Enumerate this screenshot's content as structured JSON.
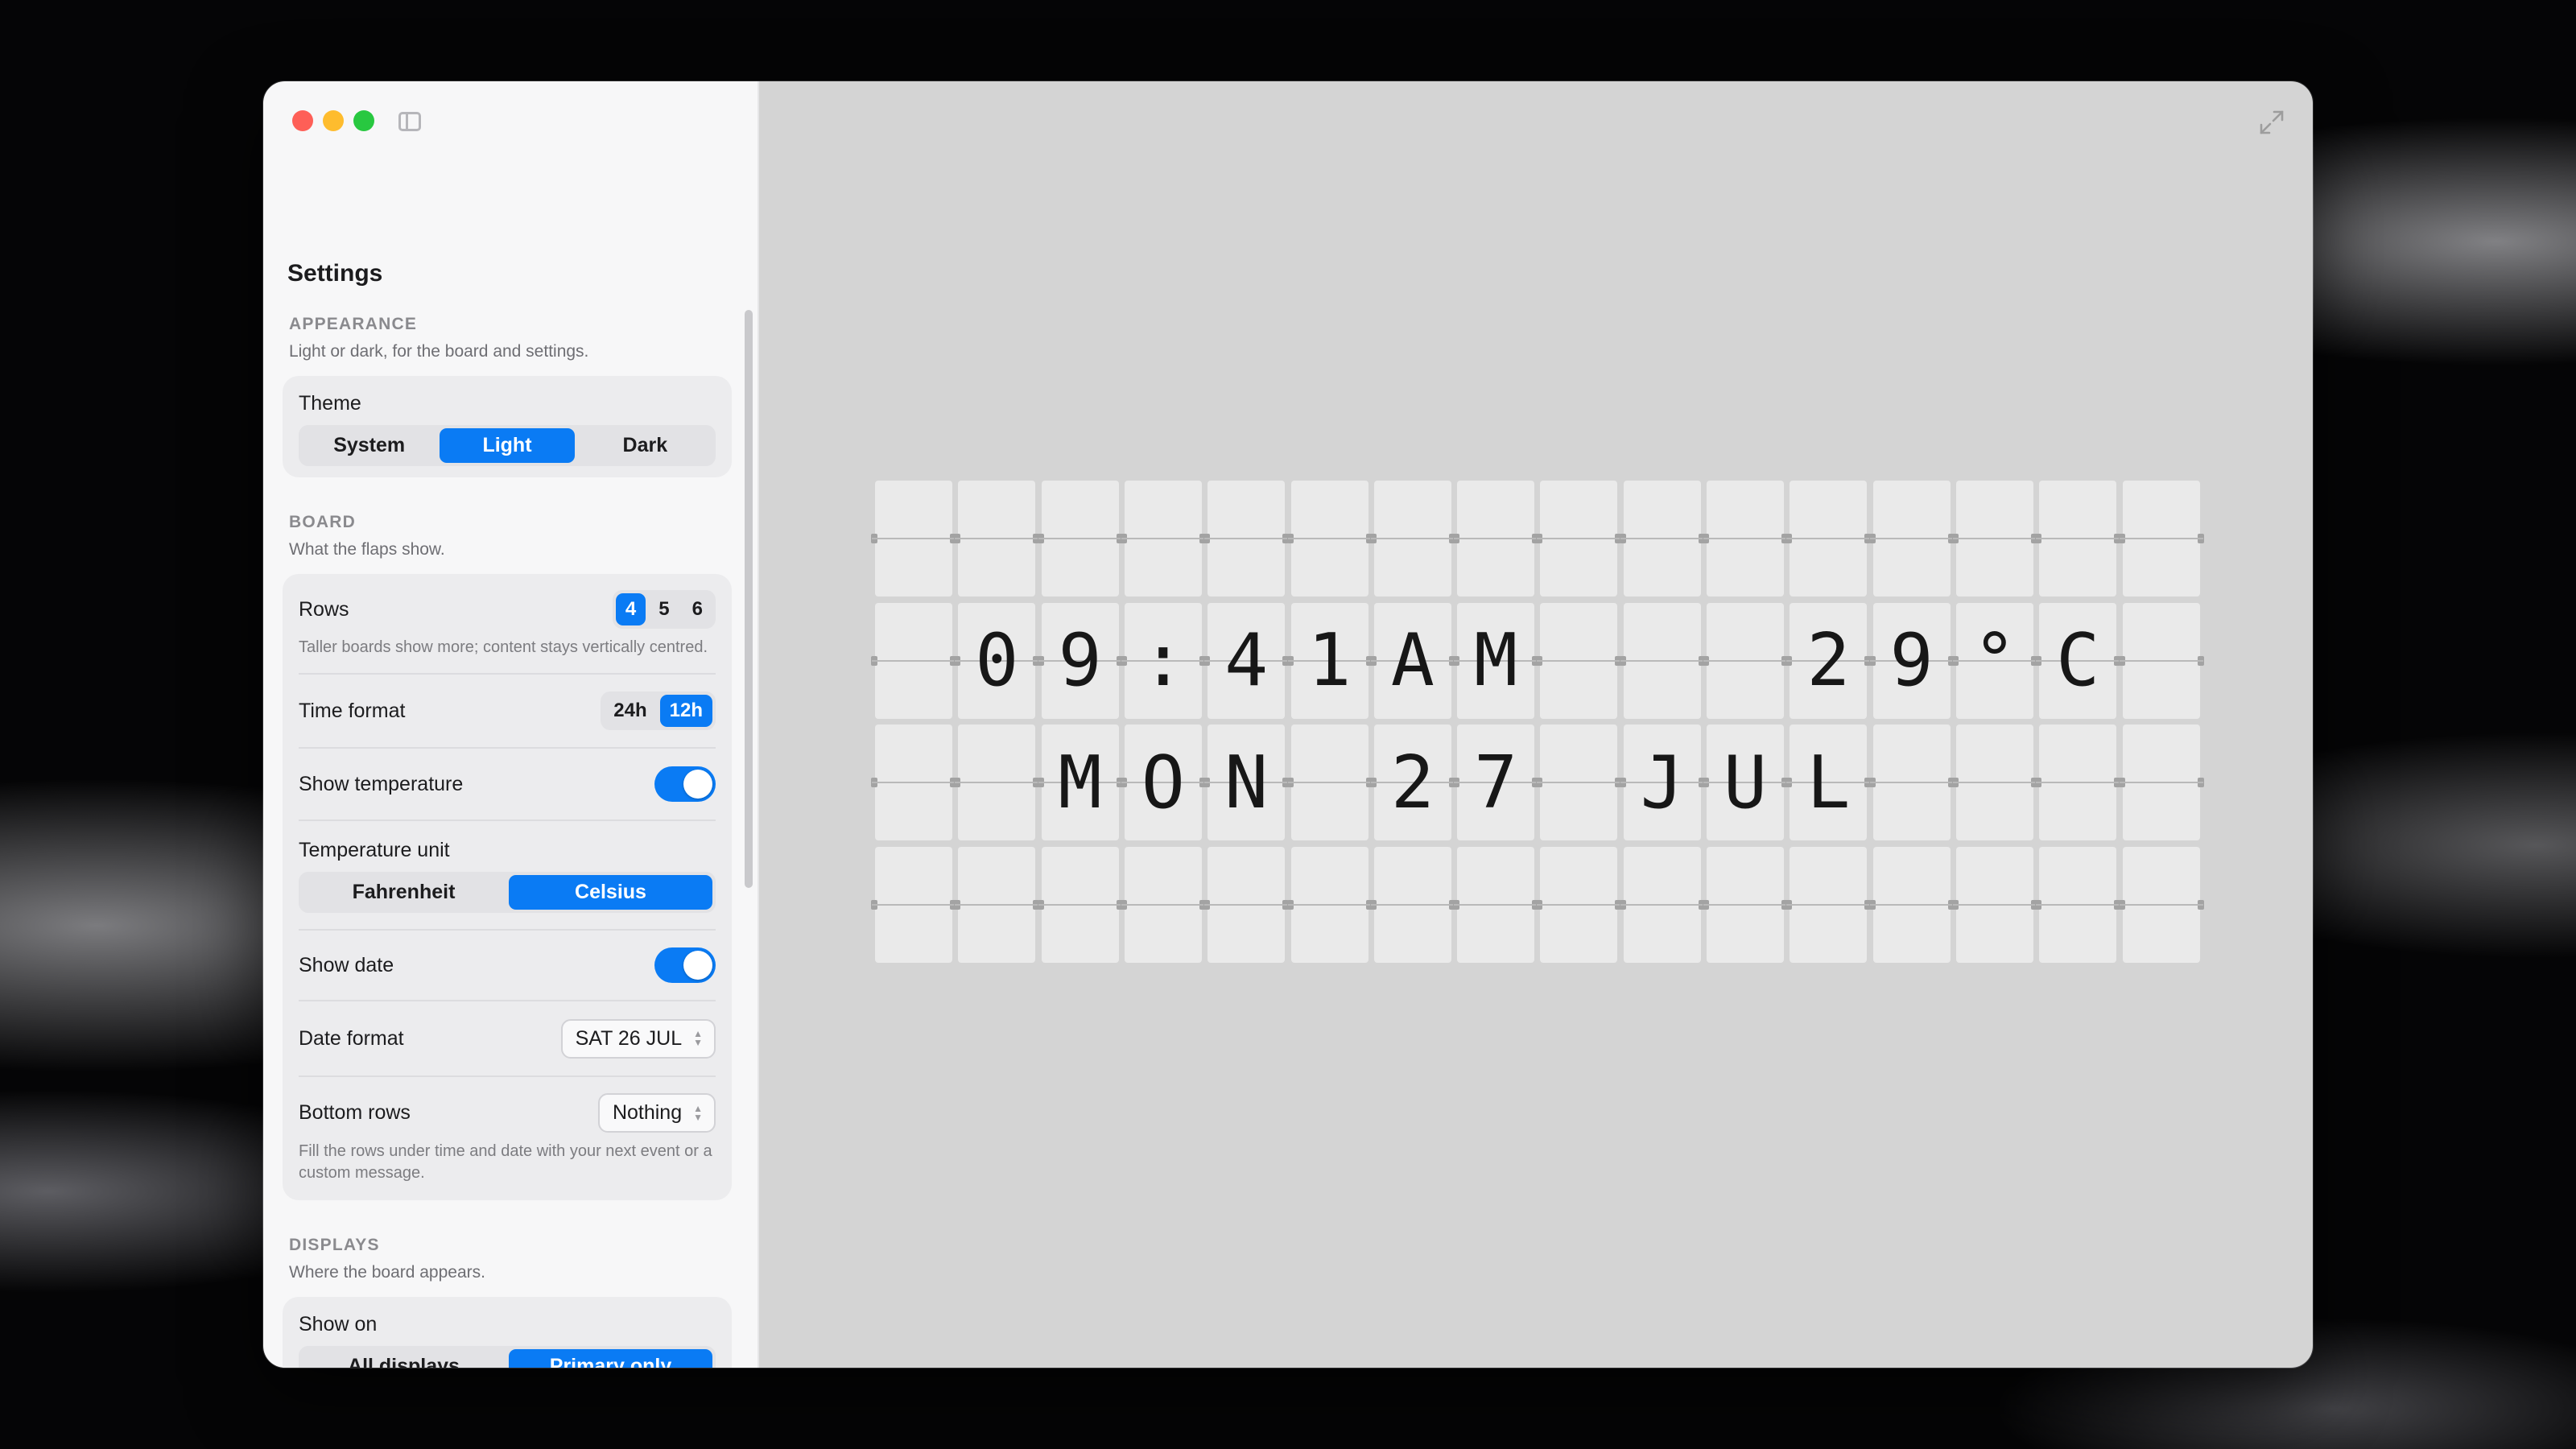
{
  "sidebar": {
    "title": "Settings",
    "appearance": {
      "header": "APPEARANCE",
      "desc": "Light or dark, for the board and settings.",
      "theme_label": "Theme",
      "theme_options": [
        "System",
        "Light",
        "Dark"
      ],
      "theme_selected": "Light"
    },
    "board": {
      "header": "BOARD",
      "desc": "What the flaps show.",
      "rows_label": "Rows",
      "rows_options": [
        "4",
        "5",
        "6"
      ],
      "rows_selected": "4",
      "rows_hint": "Taller boards show more; content stays vertically centred.",
      "time_format_label": "Time format",
      "time_format_options": [
        "24h",
        "12h"
      ],
      "time_format_selected": "12h",
      "show_temperature_label": "Show temperature",
      "show_temperature": true,
      "temperature_unit_label": "Temperature unit",
      "temperature_unit_options": [
        "Fahrenheit",
        "Celsius"
      ],
      "temperature_unit_selected": "Celsius",
      "show_date_label": "Show date",
      "show_date": true,
      "date_format_label": "Date format",
      "date_format_value": "SAT 26 JUL",
      "bottom_rows_label": "Bottom rows",
      "bottom_rows_value": "Nothing",
      "bottom_rows_hint": "Fill the rows under time and date with your next event or a custom message."
    },
    "displays": {
      "header": "DISPLAYS",
      "desc": "Where the board appears.",
      "show_on_label": "Show on",
      "show_on_options": [
        "All displays",
        "Primary only"
      ],
      "show_on_selected": "Primary only"
    }
  },
  "board_display": {
    "columns": 16,
    "rows": [
      "                ",
      " 09:41AM   29°C ",
      "  MON 27 JUL    ",
      "                "
    ]
  },
  "colors": {
    "accent": "#0a7bf4",
    "board_bg": "#d4d4d4",
    "flap": "#eaeaea",
    "flap_text": "#171717"
  },
  "icons": {
    "sidebar_toggle": "sidebar-icon",
    "fullscreen": "expand-icon"
  }
}
